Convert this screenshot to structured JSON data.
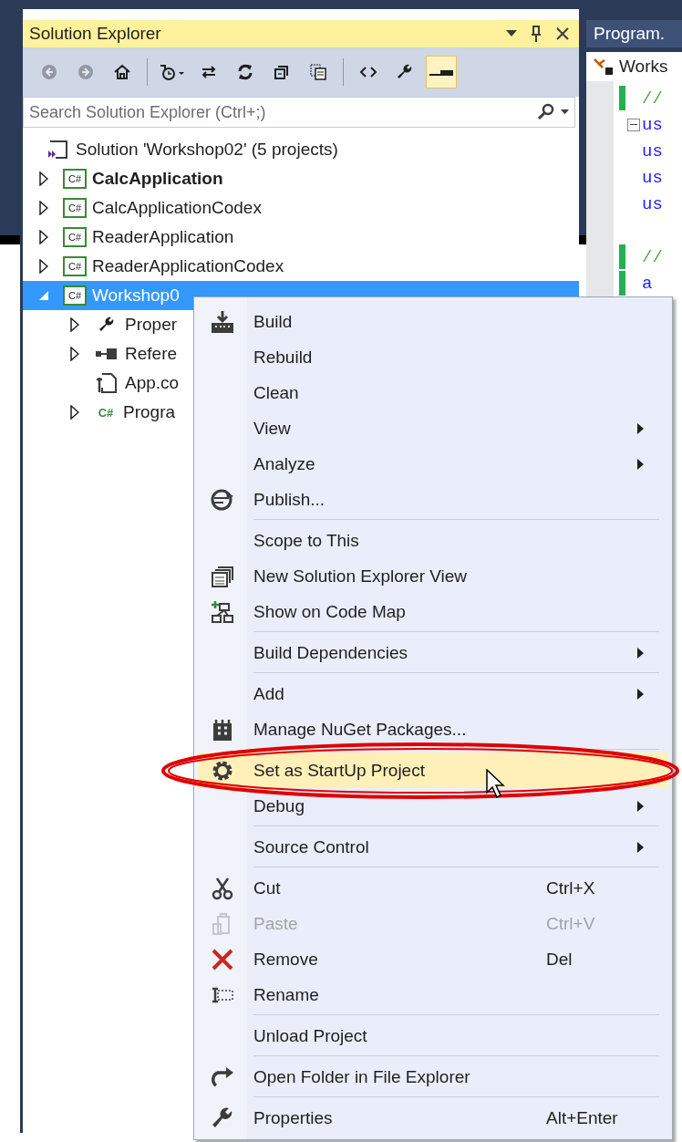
{
  "panel": {
    "title": "Solution Explorer",
    "search": {
      "placeholder": "Search Solution Explorer (Ctrl+;)"
    },
    "toolbar": [
      {
        "disabled": true,
        "selected": false
      },
      {
        "disabled": true,
        "selected": false
      },
      {
        "disabled": false,
        "selected": false
      },
      {
        "disabled": false,
        "selected": false
      },
      {
        "disabled": false,
        "selected": false
      },
      {
        "disabled": false,
        "selected": false
      },
      {
        "disabled": false,
        "selected": false
      },
      {
        "disabled": false,
        "selected": false
      },
      {
        "disabled": false,
        "selected": false
      },
      {
        "disabled": false,
        "selected": false
      },
      {
        "disabled": false,
        "selected": true
      }
    ],
    "tree": [
      {
        "kind": "solution",
        "label": "Solution 'Workshop02' (5 projects)",
        "selected": false,
        "children": [
          {
            "kind": "project",
            "badge": "C#",
            "label": "CalcApplication",
            "bold": true,
            "expanded": false,
            "selected": false
          },
          {
            "kind": "project",
            "badge": "C#",
            "label": "CalcApplicationCodex",
            "bold": false,
            "expanded": false,
            "selected": false
          },
          {
            "kind": "project",
            "badge": "C#",
            "label": "ReaderApplication",
            "bold": false,
            "expanded": false,
            "selected": false
          },
          {
            "kind": "project",
            "badge": "C#",
            "label": "ReaderApplicationCodex",
            "bold": false,
            "expanded": false,
            "selected": false
          },
          {
            "kind": "project",
            "badge": "C#",
            "label": "Workshop0",
            "bold": false,
            "expanded": true,
            "selected": true,
            "children": [
              {
                "kind": "properties",
                "label": "Proper",
                "expanded": false,
                "selected": false
              },
              {
                "kind": "references",
                "label": "Refere",
                "expanded": false,
                "selected": false
              },
              {
                "kind": "config",
                "label": "App.co",
                "selected": false
              },
              {
                "kind": "csfile",
                "badge": "C#",
                "label": "Progra",
                "expanded": false,
                "selected": false
              }
            ]
          }
        ]
      }
    ]
  },
  "editor": {
    "tab": "Program.",
    "nav": "Works",
    "lines": [
      {
        "kind": "comment",
        "text": "//",
        "changed": true
      },
      {
        "kind": "keyword",
        "text": "us",
        "fold": true,
        "changed": false
      },
      {
        "kind": "keyword",
        "text": "us",
        "changed": false
      },
      {
        "kind": "keyword",
        "text": "us",
        "changed": false
      },
      {
        "kind": "keyword",
        "text": "us",
        "changed": false
      },
      {
        "kind": "blank",
        "changed": false
      },
      {
        "kind": "comment",
        "text": "//",
        "changed": true
      },
      {
        "kind": "keyword",
        "text": "a",
        "changed": true
      }
    ]
  },
  "context_menu": [
    {
      "kind": "item",
      "label": "Build",
      "submenu": false,
      "disabled": false,
      "selected": false
    },
    {
      "kind": "item",
      "label": "Rebuild",
      "submenu": false,
      "disabled": false,
      "selected": false
    },
    {
      "kind": "item",
      "label": "Clean",
      "submenu": false,
      "disabled": false,
      "selected": false
    },
    {
      "kind": "item",
      "label": "View",
      "submenu": true,
      "disabled": false,
      "selected": false
    },
    {
      "kind": "item",
      "label": "Analyze",
      "submenu": true,
      "disabled": false,
      "selected": false
    },
    {
      "kind": "item",
      "label": "Publish...",
      "submenu": false,
      "disabled": false,
      "selected": false
    },
    {
      "kind": "separator"
    },
    {
      "kind": "item",
      "label": "Scope to This",
      "submenu": false,
      "disabled": false,
      "selected": false
    },
    {
      "kind": "item",
      "label": "New Solution Explorer View",
      "submenu": false,
      "disabled": false,
      "selected": false
    },
    {
      "kind": "item",
      "label": "Show on Code Map",
      "submenu": false,
      "disabled": false,
      "selected": false
    },
    {
      "kind": "separator"
    },
    {
      "kind": "item",
      "label": "Build Dependencies",
      "submenu": true,
      "disabled": false,
      "selected": false
    },
    {
      "kind": "separator"
    },
    {
      "kind": "item",
      "label": "Add",
      "submenu": true,
      "disabled": false,
      "selected": false
    },
    {
      "kind": "item",
      "label": "Manage NuGet Packages...",
      "submenu": false,
      "disabled": false,
      "selected": false
    },
    {
      "kind": "separator"
    },
    {
      "kind": "item",
      "label": "Set as StartUp Project",
      "submenu": false,
      "disabled": false,
      "selected": true
    },
    {
      "kind": "item",
      "label": "Debug",
      "submenu": true,
      "disabled": false,
      "selected": false
    },
    {
      "kind": "separator"
    },
    {
      "kind": "item",
      "label": "Source Control",
      "submenu": true,
      "disabled": false,
      "selected": false
    },
    {
      "kind": "separator"
    },
    {
      "kind": "item",
      "label": "Cut",
      "shortcut": "Ctrl+X",
      "submenu": false,
      "disabled": false,
      "selected": false
    },
    {
      "kind": "item",
      "label": "Paste",
      "shortcut": "Ctrl+V",
      "submenu": false,
      "disabled": true,
      "selected": false
    },
    {
      "kind": "item",
      "label": "Remove",
      "shortcut": "Del",
      "submenu": false,
      "disabled": false,
      "selected": false
    },
    {
      "kind": "item",
      "label": "Rename",
      "submenu": false,
      "disabled": false,
      "selected": false
    },
    {
      "kind": "separator"
    },
    {
      "kind": "item",
      "label": "Unload Project",
      "submenu": false,
      "disabled": false,
      "selected": false
    },
    {
      "kind": "separator"
    },
    {
      "kind": "item",
      "label": "Open Folder in File Explorer",
      "submenu": false,
      "disabled": false,
      "selected": false
    },
    {
      "kind": "separator"
    },
    {
      "kind": "item",
      "label": "Properties",
      "shortcut": "Alt+Enter",
      "submenu": false,
      "disabled": false,
      "selected": false
    }
  ]
}
